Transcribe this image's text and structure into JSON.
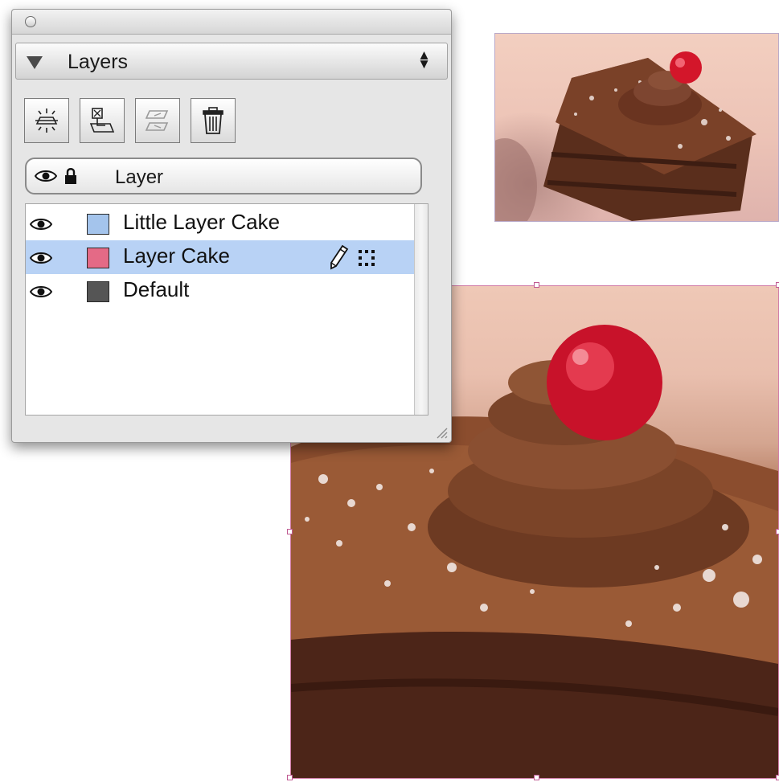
{
  "palette": {
    "title": "Layers",
    "menu_arrows": "◆",
    "header_label": "Layer",
    "toolbar": [
      {
        "name": "new-layer-button",
        "icon": "new-layer-icon"
      },
      {
        "name": "move-selection-button",
        "icon": "move-to-layer-icon"
      },
      {
        "name": "duplicate-layer-button",
        "icon": "duplicate-layer-icon"
      },
      {
        "name": "delete-layer-button",
        "icon": "trash-icon"
      }
    ],
    "layers": [
      {
        "name": "Little Layer Cake",
        "color": "#a4c4ec",
        "visible": true,
        "selected": false
      },
      {
        "name": "Layer Cake",
        "color": "#e46a86",
        "visible": true,
        "selected": true
      },
      {
        "name": "Default",
        "color": "#555555",
        "visible": true,
        "selected": false
      }
    ]
  },
  "canvas": {
    "selection_color": "#c05a92",
    "images": [
      {
        "name": "cake-photo-small"
      },
      {
        "name": "cake-photo-large"
      }
    ]
  }
}
